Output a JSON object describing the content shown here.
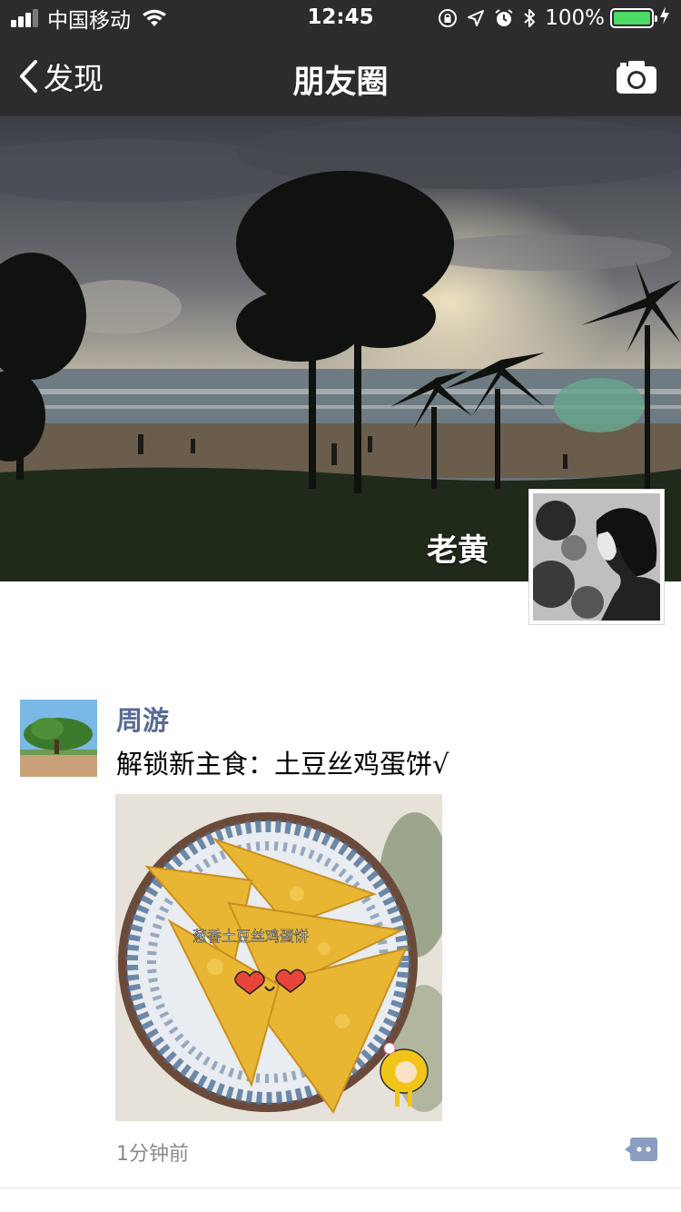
{
  "status_bar": {
    "carrier": "中国移动",
    "time": "12:45",
    "battery": "100%",
    "battery_level": 1.0,
    "signal_bars": 4,
    "signal_bars_filled": 3,
    "icons": [
      "signal-icon",
      "wifi-icon",
      "rotation-lock-icon",
      "location-icon",
      "alarm-icon",
      "bluetooth-icon",
      "battery-icon",
      "charging-bolt-icon"
    ]
  },
  "nav": {
    "back_label": "发现",
    "title": "朋友圈",
    "camera_icon": "camera-icon"
  },
  "profile": {
    "name": "老黄"
  },
  "post": {
    "author": "周游",
    "text": "解锁新主食：土豆丝鸡蛋饼√",
    "image_caption": "葱香土豆丝鸡蛋饼",
    "time": "1分钟前",
    "comment_icon": "comment-icon"
  },
  "colors": {
    "topbar": "#2c2c2e",
    "link_blue": "#576b95",
    "battery_green": "#4cd964",
    "comment_btn": "#8b9dc3"
  }
}
